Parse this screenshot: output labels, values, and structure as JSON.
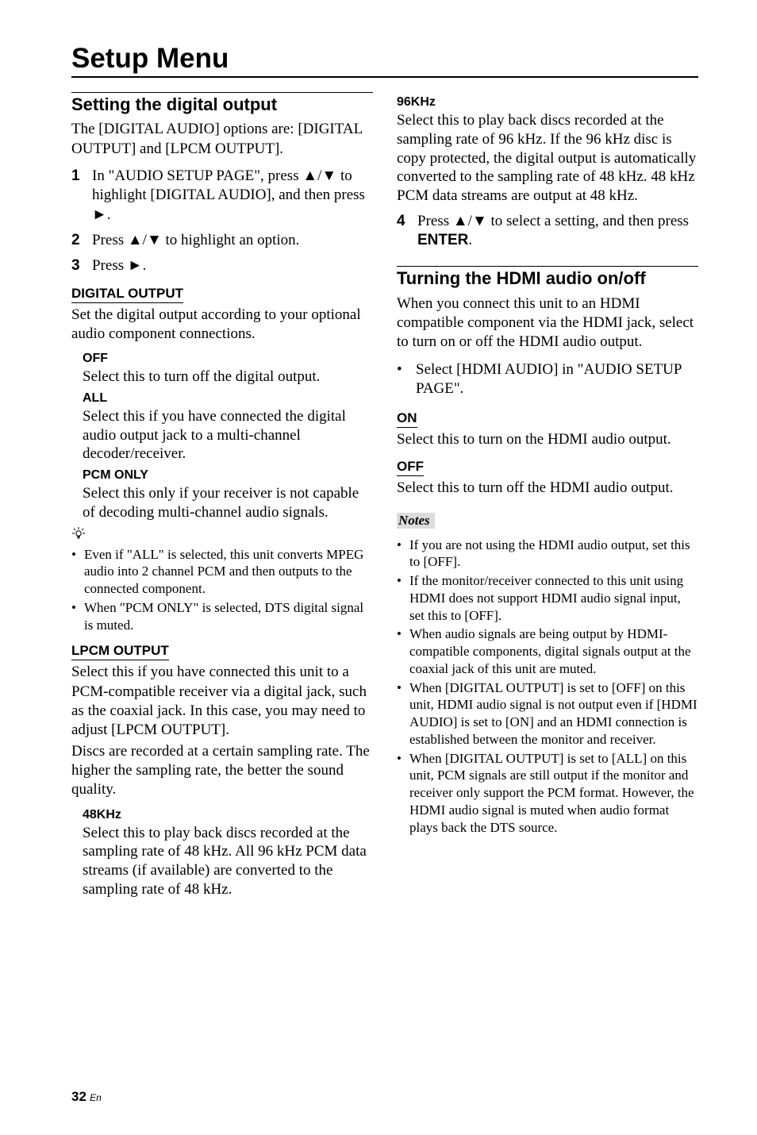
{
  "chapter": "Setup Menu",
  "left": {
    "section_title": "Setting the digital output",
    "section_intro": "The [DIGITAL AUDIO] options are: [DIGITAL OUTPUT] and [LPCM OUTPUT].",
    "steps": [
      "In \"AUDIO SETUP PAGE\", press ▲/▼ to highlight [DIGITAL AUDIO], and then press ►.",
      "Press ▲/▼ to highlight an option.",
      "Press ►."
    ],
    "digital_output": {
      "heading": "DIGITAL OUTPUT",
      "body": "Set the digital output according to your optional audio component connections.",
      "opts": [
        {
          "label": "OFF",
          "text": "Select this to turn off the digital output."
        },
        {
          "label": "ALL",
          "text": "Select this if you have connected the digital audio output jack to a multi-channel decoder/receiver."
        },
        {
          "label": "PCM ONLY",
          "text": "Select this only if your receiver is not capable of decoding multi-channel audio signals."
        }
      ]
    },
    "tips": [
      "Even if \"ALL\" is selected, this unit converts MPEG audio into 2 channel PCM and then outputs to the connected component.",
      "When \"PCM ONLY\" is selected, DTS digital signal is muted."
    ],
    "lpcm": {
      "heading": "LPCM OUTPUT",
      "body1": "Select this if you have connected this unit to a PCM-compatible receiver via a digital jack, such as the coaxial jack. In this case, you may need to adjust [LPCM OUTPUT].",
      "body2": "Discs are recorded at a certain sampling rate. The higher the sampling rate, the better the sound quality.",
      "opts": [
        {
          "label": "48KHz",
          "text": "Select this to play back discs recorded at the sampling rate of 48 kHz. All 96 kHz PCM data streams (if available) are converted to the sampling rate of 48 kHz."
        }
      ]
    }
  },
  "right": {
    "opt96": {
      "label": "96KHz",
      "text": "Select this to play back discs recorded at the sampling rate of 96 kHz. If the 96 kHz disc is copy protected, the digital output is automatically converted to the sampling rate of 48 kHz. 48 kHz PCM data streams are output at 48 kHz."
    },
    "step4_pre": "Press ▲/▼ to select a setting, and then press ",
    "step4_bold": "ENTER",
    "step4_post": ".",
    "hdmi": {
      "title": "Turning the HDMI audio on/off",
      "intro": "When you connect this unit to an HDMI compatible component via the HDMI jack, select to turn on or off the HDMI audio output.",
      "action": "Select [HDMI AUDIO] in \"AUDIO SETUP PAGE\".",
      "on": {
        "heading": "ON",
        "text": "Select this to turn on the HDMI audio output."
      },
      "off": {
        "heading": "OFF",
        "text": "Select this to turn off the HDMI audio output."
      }
    },
    "notes_label": "Notes",
    "notes": [
      "If you are not using the HDMI audio output, set this to [OFF].",
      "If the monitor/receiver connected to this unit using HDMI does not support HDMI audio signal input, set this to [OFF].",
      "When audio signals are being output by HDMI-compatible components, digital signals output at the coaxial jack of this unit are muted.",
      "When [DIGITAL OUTPUT] is set to [OFF] on this unit, HDMI audio signal is not output even if [HDMI AUDIO] is set to [ON] and an HDMI connection is established between the monitor and receiver.",
      "When [DIGITAL OUTPUT] is set to [ALL] on this unit, PCM signals are still output if the monitor and receiver only support the PCM format. However, the HDMI audio signal is muted when audio format plays back the DTS source."
    ]
  },
  "page_num": "32",
  "page_suffix": "En"
}
